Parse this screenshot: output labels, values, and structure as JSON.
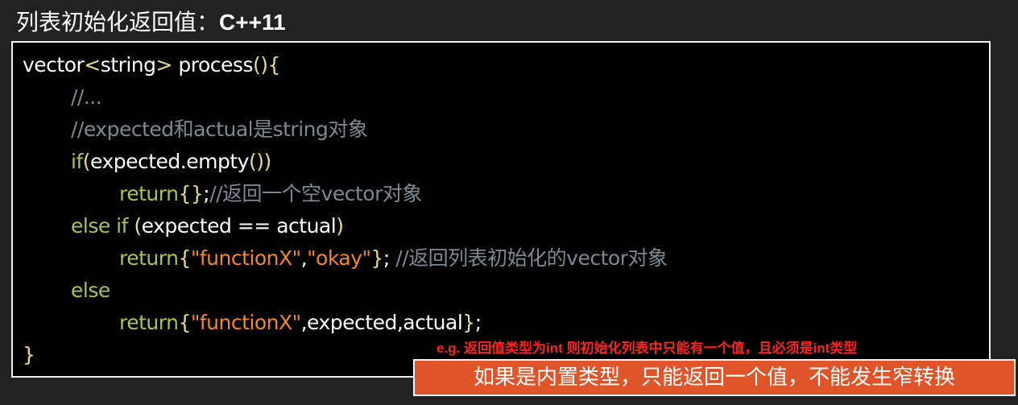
{
  "title": {
    "cn": "列表初始化返回值：",
    "ver": "C++11"
  },
  "code_lines": [
    {
      "indent": 0,
      "tokens": [
        [
          "tx",
          "vector"
        ],
        [
          "br",
          "<"
        ],
        [
          "tx",
          "string"
        ],
        [
          "br",
          ">"
        ],
        [
          "tx",
          " process"
        ],
        [
          "br",
          "(){"
        ]
      ]
    },
    {
      "indent": 1,
      "tokens": [
        [
          "cm",
          "//..."
        ]
      ]
    },
    {
      "indent": 1,
      "tokens": [
        [
          "cm",
          "//expected和actual是string对象"
        ]
      ]
    },
    {
      "indent": 1,
      "tokens": [
        [
          "kw",
          "if"
        ],
        [
          "br",
          "("
        ],
        [
          "tx",
          "expected.empty"
        ],
        [
          "br",
          "())"
        ]
      ]
    },
    {
      "indent": 2,
      "tokens": [
        [
          "kw",
          "return"
        ],
        [
          "br",
          "{}"
        ],
        [
          "tx",
          ";"
        ],
        [
          "cm",
          "//返回一个空vector对象"
        ]
      ]
    },
    {
      "indent": 1,
      "tokens": [
        [
          "kw",
          "else if "
        ],
        [
          "br",
          "("
        ],
        [
          "tx",
          "expected == actual"
        ],
        [
          "br",
          ")"
        ]
      ]
    },
    {
      "indent": 2,
      "tokens": [
        [
          "kw",
          "return"
        ],
        [
          "br",
          "{"
        ],
        [
          "str",
          "\"functionX\""
        ],
        [
          "tx",
          ","
        ],
        [
          "str",
          "\"okay\""
        ],
        [
          "br",
          "}"
        ],
        [
          "tx",
          "; "
        ],
        [
          "cm",
          "//返回列表初始化的vector对象"
        ]
      ]
    },
    {
      "indent": 1,
      "tokens": [
        [
          "kw",
          "else"
        ]
      ]
    },
    {
      "indent": 2,
      "tokens": [
        [
          "kw",
          "return"
        ],
        [
          "br",
          "{"
        ],
        [
          "str",
          "\"functionX\""
        ],
        [
          "tx",
          ",expected,actual"
        ],
        [
          "br",
          "}"
        ],
        [
          "tx",
          ";"
        ]
      ]
    },
    {
      "indent": 0,
      "tokens": [
        [
          "br",
          "}"
        ]
      ]
    }
  ],
  "note": "e.g. 返回值类型为int  则初始化列表中只能有一个值，且必须是int类型",
  "banner": "如果是内置类型，只能返回一个值，不能发生窄转换"
}
